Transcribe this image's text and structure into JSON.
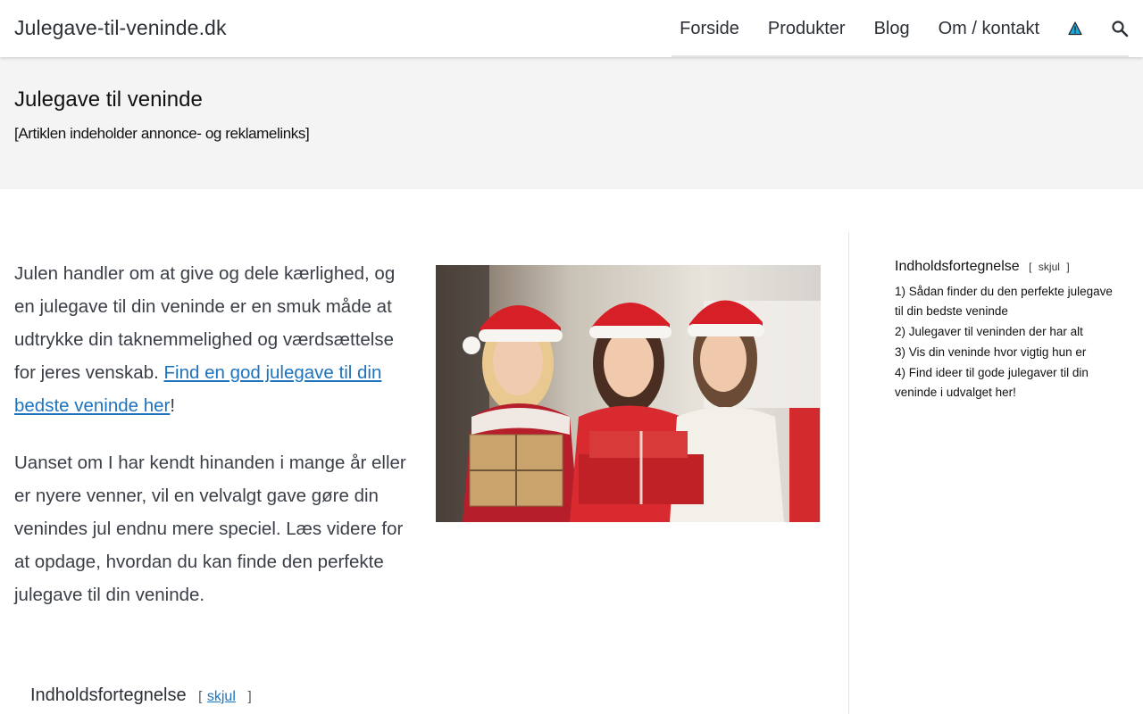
{
  "header": {
    "site_title": "Julegave-til-veninde.dk",
    "nav": [
      {
        "label": "Forside"
      },
      {
        "label": "Produkter"
      },
      {
        "label": "Blog"
      },
      {
        "label": "Om / kontakt"
      }
    ],
    "icons": {
      "warning": "warning-icon",
      "search": "search-icon"
    }
  },
  "hero": {
    "title": "Julegave til veninde",
    "disclaimer": "[Artiklen indeholder annonce- og reklamelinks]"
  },
  "content": {
    "para1_text": "Julen handler om at give og dele kærlighed, og en julegave til din veninde er en smuk måde at udtrykke din taknemmelighed og værdsættelse for jeres venskab. ",
    "para1_link": "Find en god julegave til din bedste veninde her",
    "para1_end": "!",
    "para2": "Uanset om I har kendt hinanden i mange år eller er nyere venner, vil en velvalgt gave gøre din venindes jul endnu mere speciel. Læs videre for at opdage, hvordan du kan finde den perfekte julegave til din veninde."
  },
  "toc_inline": {
    "title": "Indholdsfortegnelse",
    "open": "[",
    "toggle": "skjul",
    "close": "]"
  },
  "sidebar_toc": {
    "title": "Indholdsfortegnelse",
    "open": "[",
    "toggle": "skjul",
    "close": "]",
    "items": [
      "1) Sådan finder du den perfekte julegave til din bedste veninde",
      "2) Julegaver til veninden der har alt",
      "3) Vis din veninde hvor vigtig hun er",
      "4) Find ideer til gode julegaver til din veninde i udvalget her!"
    ]
  },
  "colors": {
    "link": "#1e73be",
    "hero_bg": "#f4f4f4",
    "warning": "#1aa7d9"
  }
}
